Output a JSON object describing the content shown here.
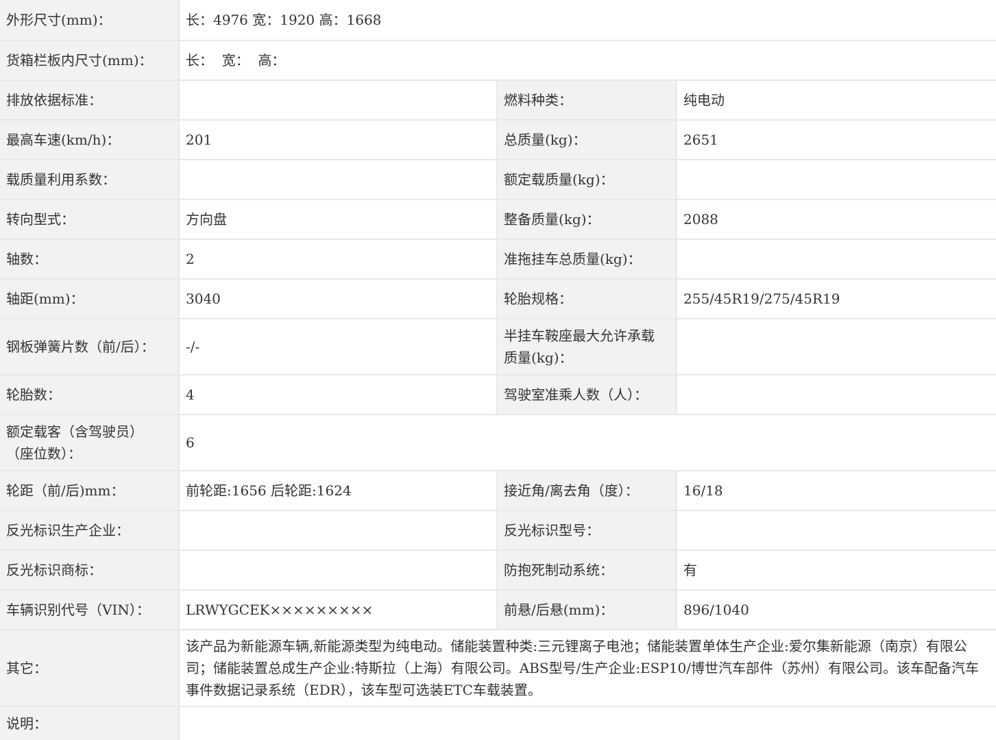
{
  "rows": [
    {
      "label": "外形尺寸(mm)：",
      "value": "长：4976 宽：1920 高：1668"
    },
    {
      "label": "货箱栏板内尺寸(mm)：",
      "value": "长：  宽：  高："
    },
    {
      "label": "排放依据标准：",
      "value": "",
      "label2": "燃料种类：",
      "value2": "纯电动"
    },
    {
      "label": "最高车速(km/h)：",
      "value": "201",
      "label2": "总质量(kg)：",
      "value2": "2651"
    },
    {
      "label": "载质量利用系数：",
      "value": "",
      "label2": "额定载质量(kg)：",
      "value2": ""
    },
    {
      "label": "转向型式：",
      "value": "方向盘",
      "label2": "整备质量(kg)：",
      "value2": "2088"
    },
    {
      "label": "轴数：",
      "value": "2",
      "label2": "准拖挂车总质量(kg)：",
      "value2": ""
    },
    {
      "label": "轴距(mm)：",
      "value": "3040",
      "label2": "轮胎规格：",
      "value2": "255/45R19/275/45R19"
    },
    {
      "label": "钢板弹簧片数（前/后）：",
      "value": "-/-",
      "label2": "半挂车鞍座最大允许承载质量(kg)：",
      "value2": ""
    },
    {
      "label": "轮胎数：",
      "value": "4",
      "label2": "驾驶室准乘人数（人）：",
      "value2": ""
    },
    {
      "label": "额定载客（含驾驶员）（座位数）：",
      "value": "6"
    },
    {
      "label": "轮距（前/后)mm：",
      "value": "前轮距:1656 后轮距:1624",
      "label2": "接近角/离去角（度）：",
      "value2": "16/18"
    },
    {
      "label": "反光标识生产企业：",
      "value": "",
      "label2": "反光标识型号：",
      "value2": ""
    },
    {
      "label": "反光标识商标：",
      "value": "",
      "label2": "防抱死制动系统：",
      "value2": "有"
    },
    {
      "label": "车辆识别代号（VIN）：",
      "value": "LRWYGCEK×××××××××",
      "label2": "前悬/后悬(mm)：",
      "value2": "896/1040"
    },
    {
      "label": "其它：",
      "value": "该产品为新能源车辆,新能源类型为纯电动。储能装置种类:三元锂离子电池；储能装置单体生产企业:爱尔集新能源（南京）有限公司；储能装置总成生产企业:特斯拉（上海）有限公司。ABS型号/生产企业:ESP10/博世汽车部件（苏州）有限公司。该车配备汽车事件数据记录系统（EDR），该车型可选装ETC车载装置。"
    },
    {
      "label": "说明：",
      "value": ""
    }
  ]
}
